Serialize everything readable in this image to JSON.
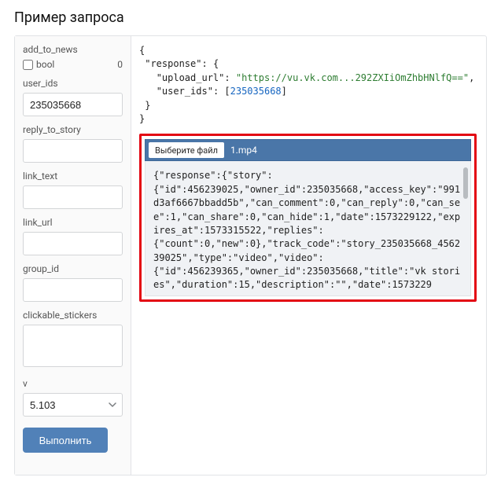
{
  "title": "Пример запроса",
  "sidebar": {
    "add_to_news": {
      "label": "add_to_news",
      "bool_label": "bool",
      "value_display": "0"
    },
    "user_ids": {
      "label": "user_ids",
      "value": "235035668"
    },
    "reply_to_story": {
      "label": "reply_to_story",
      "value": ""
    },
    "link_text": {
      "label": "link_text",
      "value": ""
    },
    "link_url": {
      "label": "link_url",
      "value": ""
    },
    "group_id": {
      "label": "group_id",
      "value": ""
    },
    "clickable_stickers": {
      "label": "clickable_stickers",
      "value": ""
    },
    "v": {
      "label": "v",
      "value": "5.103"
    },
    "run_label": "Выполнить"
  },
  "response_top": {
    "upload_url": "https://vu.vk.com...292ZXIiOmZhbHNlfQ==",
    "user_ids": [
      235035668
    ]
  },
  "upload": {
    "button_label": "Выберите файл",
    "filename": "1.mp4"
  },
  "response_body_text": "{\"response\":{\"story\":\n{\"id\":456239025,\"owner_id\":235035668,\"access_key\":\"991d3af6667bbadd5b\",\"can_comment\":0,\"can_reply\":0,\"can_see\":1,\"can_share\":0,\"can_hide\":1,\"date\":1573229122,\"expires_at\":1573315522,\"replies\":\n{\"count\":0,\"new\":0},\"track_code\":\"story_235035668_456239025\",\"type\":\"video\",\"video\":\n{\"id\":456239365,\"owner_id\":235035668,\"title\":\"vk stories\",\"duration\":15,\"description\":\"\",\"date\":1573229"
}
